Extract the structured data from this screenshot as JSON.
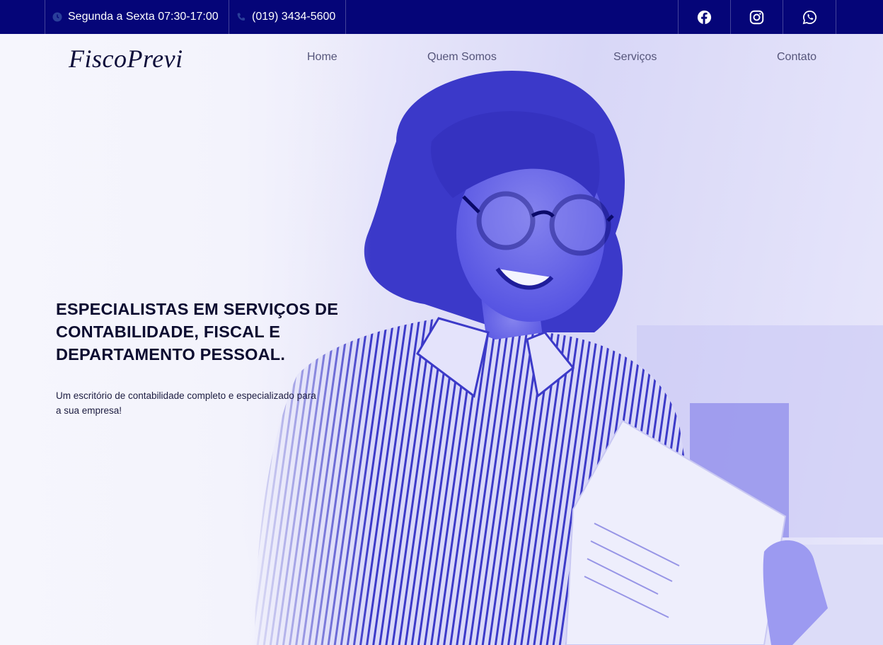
{
  "topbar": {
    "hours": "Segunda a Sexta 07:30-17:00",
    "phone": "(019) 3434-5600",
    "hours_icon": "clock-icon",
    "phone_icon": "phone-icon",
    "social": [
      "facebook-icon",
      "instagram-icon",
      "whatsapp-icon"
    ]
  },
  "brand": {
    "logo": "FiscoPrevi"
  },
  "nav": {
    "home": "Home",
    "quem": "Quem Somos",
    "servicos": "Serviços",
    "contato": "Contato"
  },
  "hero": {
    "headline": "ESPECIALISTAS EM SERVIÇOS DE CONTABILIDADE, FISCAL E DEPARTAMENTO PESSOAL.",
    "subtitle": "Um escritório de contabilidade completo e especializado para a sua empresa!"
  },
  "colors": {
    "topbar": "#050578",
    "accent": "#4a48e0",
    "text_dark": "#0c0c30"
  }
}
